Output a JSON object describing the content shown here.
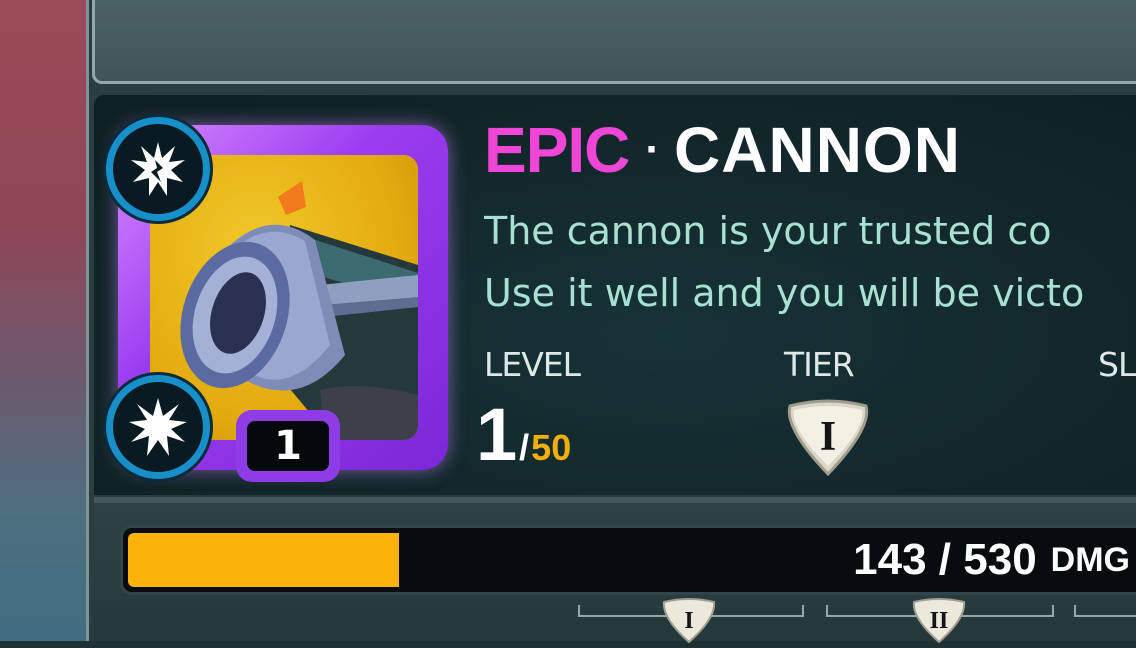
{
  "item": {
    "rarity": "EPIC",
    "separator": "·",
    "name": "CANNON",
    "description_lines": [
      "The cannon is your trusted co",
      "Use it well and you will be victo"
    ],
    "card_level": "1",
    "top_badge_icon": "burst-splat-icon",
    "bottom_badge_icon": "starburst-icon"
  },
  "stats": {
    "level_label": "LEVEL",
    "level_current": "1",
    "level_slash": "/",
    "level_max": "50",
    "tier_label": "TIER",
    "tier_value": "I",
    "slot_label": "SL"
  },
  "damage": {
    "text": "143 / 530",
    "unit": "DMG",
    "current": 143,
    "max": 530
  },
  "tier_markers": [
    "I",
    "II"
  ],
  "colors": {
    "rarity": "#f046d8",
    "description": "#a8e0d2",
    "level_max": "#f4ae0b",
    "progress_fill": "#fbb30a",
    "card_frame": "#9a3cf0",
    "badge_ring": "#1790c9"
  }
}
